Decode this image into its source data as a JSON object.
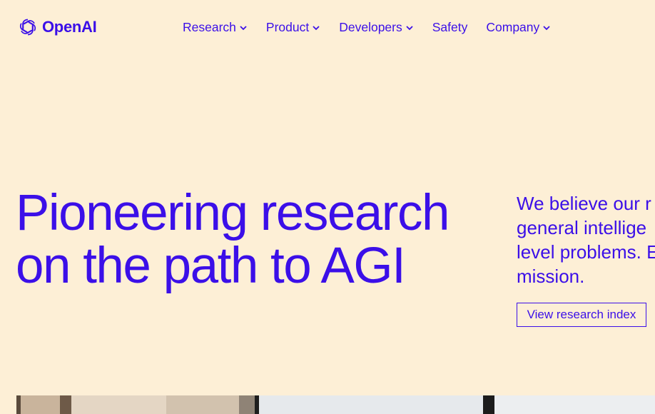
{
  "brand": {
    "name": "OpenAI",
    "logo_icon": "openai-knot-icon"
  },
  "nav": {
    "items": [
      {
        "label": "Research",
        "has_dropdown": true
      },
      {
        "label": "Product",
        "has_dropdown": true
      },
      {
        "label": "Developers",
        "has_dropdown": true
      },
      {
        "label": "Safety",
        "has_dropdown": false
      },
      {
        "label": "Company",
        "has_dropdown": true
      }
    ]
  },
  "hero": {
    "title_line1": "Pioneering research",
    "title_line2": "on the path to AGI",
    "description_lines": [
      "We believe our r",
      "general intellige",
      "level problems. E",
      "mission."
    ],
    "cta_label": "View research index"
  },
  "colors": {
    "background": "#fdefd6",
    "accent": "#3b0fe8"
  }
}
